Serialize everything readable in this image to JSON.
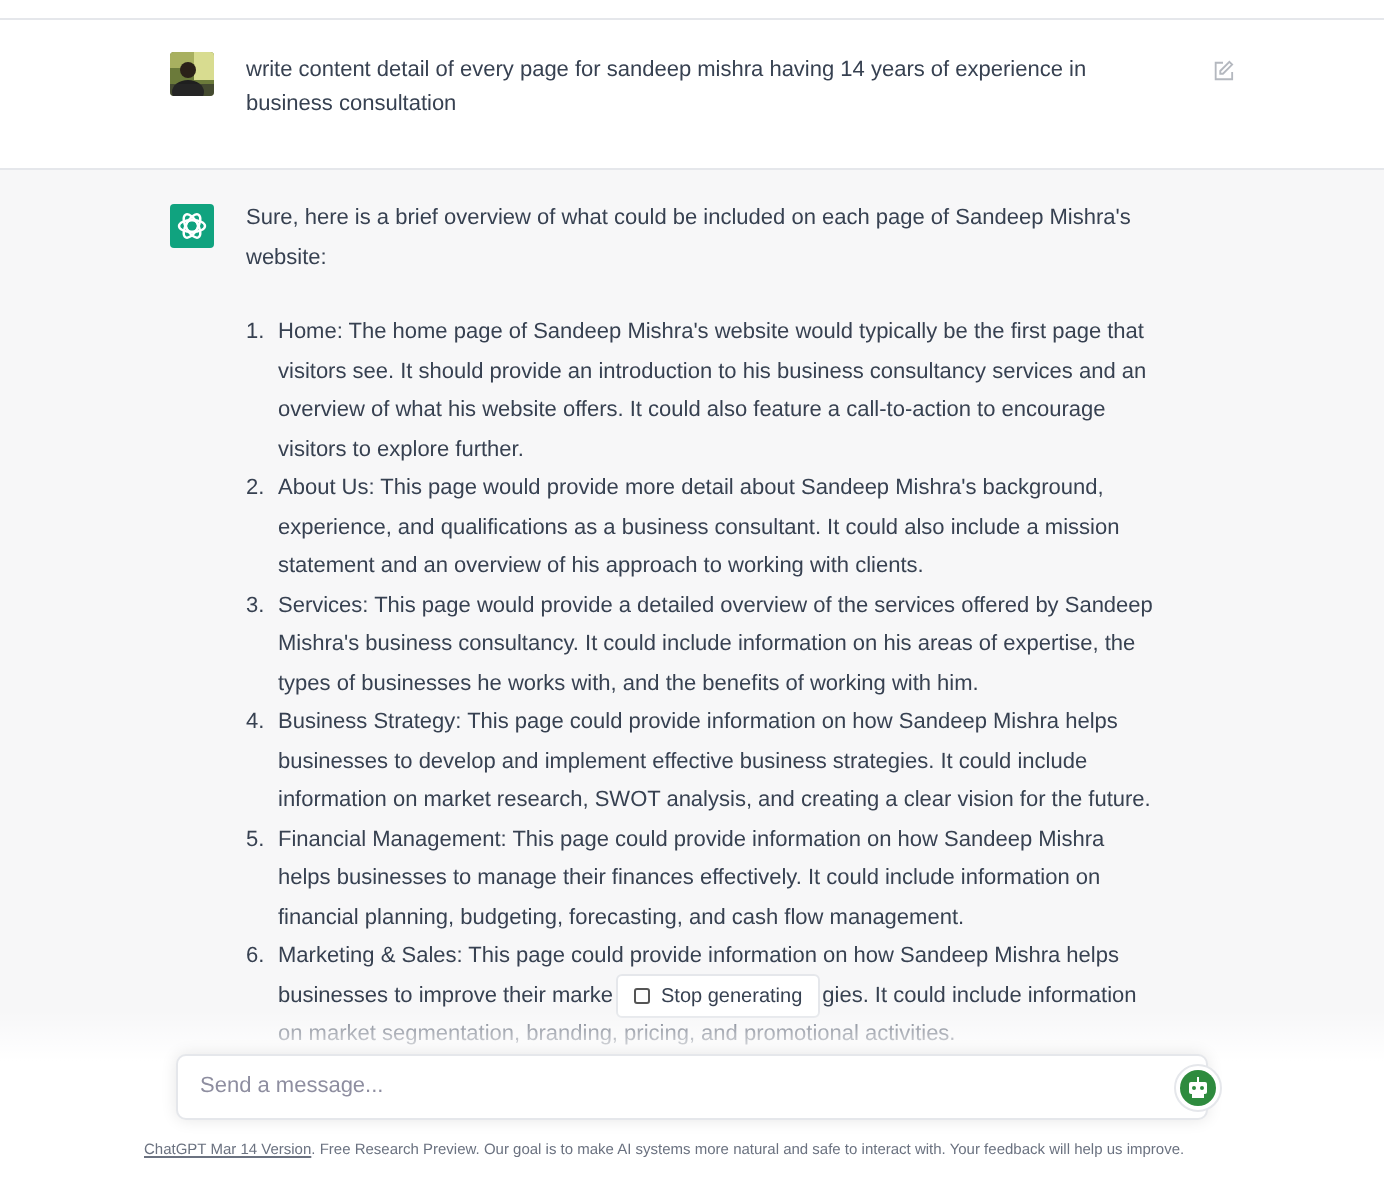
{
  "user_message": {
    "text": "write content detail of every page for sandeep mishra having 14 years of experience in business consultation"
  },
  "assistant_message": {
    "intro": "Sure, here is a brief overview of what could be included on each page of Sandeep Mishra's website:",
    "items": [
      {
        "number": "1.",
        "text": "Home: The home page of Sandeep Mishra's website would typically be the first page that visitors see. It should provide an introduction to his business consultancy services and an overview of what his website offers. It could also feature a call-to-action to encourage visitors to explore further."
      },
      {
        "number": "2.",
        "text": "About Us: This page would provide more detail about Sandeep Mishra's background, experience, and qualifications as a business consultant. It could also include a mission statement and an overview of his approach to working with clients."
      },
      {
        "number": "3.",
        "text": "Services: This page would provide a detailed overview of the services offered by Sandeep Mishra's business consultancy. It could include information on his areas of expertise, the types of businesses he works with, and the benefits of working with him."
      },
      {
        "number": "4.",
        "text": "Business Strategy: This page could provide information on how Sandeep Mishra helps businesses to develop and implement effective business strategies. It could include information on market research, SWOT analysis, and creating a clear vision for the future."
      },
      {
        "number": "5.",
        "text": "Financial Management: This page could provide information on how Sandeep Mishra helps businesses to manage their finances effectively. It could include information on financial planning, budgeting, forecasting, and cash flow management."
      },
      {
        "number": "6.",
        "text": "Marketing & Sales: This page could provide information on how Sandeep Mishra helps",
        "line_before_button": "businesses to improve their marke",
        "line_after_button": "gies. It could include information",
        "last_line": "on market segmentation, branding, pricing, and promotional activities."
      }
    ]
  },
  "stop_button": {
    "label": "Stop generating"
  },
  "composer": {
    "placeholder": "Send a message..."
  },
  "footer": {
    "link": "ChatGPT Mar 14 Version",
    "text": ". Free Research Preview. Our goal is to make AI systems more natural and safe to interact with. Your feedback will help us improve."
  }
}
